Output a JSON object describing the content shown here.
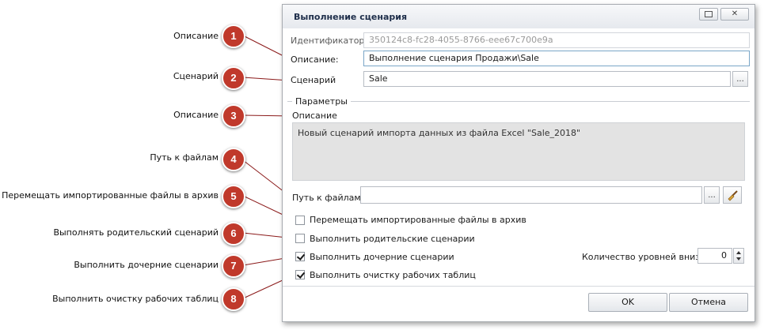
{
  "annotations": [
    {
      "num": "1",
      "label": "Описание"
    },
    {
      "num": "2",
      "label": "Сценарий"
    },
    {
      "num": "3",
      "label": "Описание"
    },
    {
      "num": "4",
      "label": "Путь к файлам"
    },
    {
      "num": "5",
      "label": "Перемещать импортированные файлы в архив"
    },
    {
      "num": "6",
      "label": "Выполнять родительский сценарий"
    },
    {
      "num": "7",
      "label": "Выполнить дочерние сценарии"
    },
    {
      "num": "8",
      "label": "Выполнить очистку рабочих таблиц"
    }
  ],
  "dialog": {
    "title": "Выполнение сценария",
    "window_buttons": {
      "restore_icon": "restore-icon",
      "close_icon": "close-icon",
      "close_glyph": "✕"
    },
    "identifier": {
      "label": "Идентификатор:",
      "value": "350124c8-fc28-4055-8766-eee67c700e9a"
    },
    "description": {
      "label": "Описание:",
      "value": "Выполнение сценария Продажи\\Sale"
    },
    "scenario": {
      "label": "Сценарий",
      "value": "Sale",
      "browse_label": "..."
    },
    "params": {
      "group_label": "Параметры",
      "description_label": "Описание",
      "description_text": "Новый сценарий импорта данных из файла Excel \"Sale_2018\""
    },
    "files_path": {
      "label": "Путь к файлам",
      "value": "",
      "browse_label": "...",
      "clear_icon": "broom-icon"
    },
    "options": [
      {
        "label": "Перемещать импортированные файлы в архив",
        "checked": false
      },
      {
        "label": "Выполнить родительские сценарии",
        "checked": false
      },
      {
        "label": "Выполнить дочерние сценарии",
        "checked": true
      },
      {
        "label": "Выполнить очистку рабочих таблиц",
        "checked": true
      }
    ],
    "levels_down": {
      "label": "Количество уровней вниз",
      "value": "0"
    },
    "ok_label": "OK",
    "cancel_label": "Отмена"
  },
  "colors": {
    "badge": "#c0392b",
    "leader": "#8b1a1a"
  }
}
